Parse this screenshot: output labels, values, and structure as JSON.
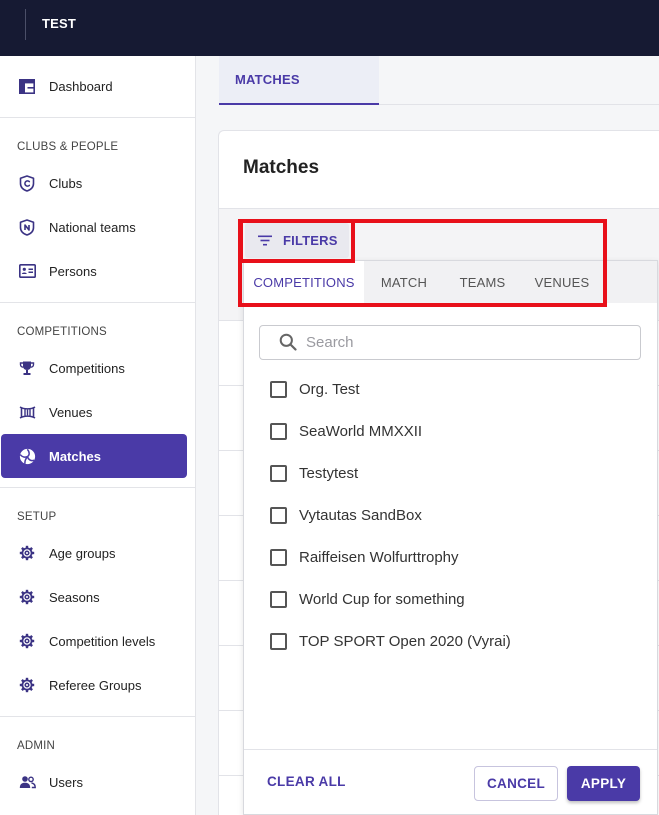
{
  "header": {
    "title": "TEST"
  },
  "sidebar": {
    "dashboard": {
      "label": "Dashboard",
      "icon": "dashboard-icon"
    },
    "sections": [
      {
        "title": "CLUBS & PEOPLE",
        "items": [
          {
            "label": "Clubs",
            "icon": "clubs-shield-icon"
          },
          {
            "label": "National teams",
            "icon": "national-teams-shield-icon"
          },
          {
            "label": "Persons",
            "icon": "id-card-icon"
          }
        ]
      },
      {
        "title": "COMPETITIONS",
        "items": [
          {
            "label": "Competitions",
            "icon": "trophy-icon"
          },
          {
            "label": "Venues",
            "icon": "stadium-icon"
          },
          {
            "label": "Matches",
            "icon": "volleyball-icon",
            "active": true
          }
        ]
      },
      {
        "title": "SETUP",
        "items": [
          {
            "label": "Age groups",
            "icon": "gear-icon"
          },
          {
            "label": "Seasons",
            "icon": "gear-icon"
          },
          {
            "label": "Competition levels",
            "icon": "gear-icon"
          },
          {
            "label": "Referee Groups",
            "icon": "gear-icon"
          }
        ]
      },
      {
        "title": "ADMIN",
        "items": [
          {
            "label": "Users",
            "icon": "users-icon"
          }
        ]
      }
    ]
  },
  "main": {
    "tabs": [
      {
        "label": "MATCHES",
        "active": true
      }
    ],
    "card_title": "Matches",
    "filters_button": {
      "label": "FILTERS",
      "icon": "filter-icon"
    }
  },
  "filter_panel": {
    "tabs": [
      {
        "label": "COMPETITIONS",
        "active": true
      },
      {
        "label": "MATCH",
        "active": false
      },
      {
        "label": "TEAMS",
        "active": false
      },
      {
        "label": "VENUES",
        "active": false
      }
    ],
    "search": {
      "placeholder": "Search",
      "value": "",
      "icon": "search-icon"
    },
    "options": [
      {
        "label": "Org. Test",
        "checked": false
      },
      {
        "label": "SeaWorld MMXXII",
        "checked": false
      },
      {
        "label": "Testytest",
        "checked": false
      },
      {
        "label": "Vytautas SandBox",
        "checked": false
      },
      {
        "label": "Raiffeisen Wolfurttrophy",
        "checked": false
      },
      {
        "label": "World Cup for something",
        "checked": false
      },
      {
        "label": "TOP SPORT Open 2020 (Vyrai)",
        "checked": false
      }
    ],
    "clear_all_label": "CLEAR ALL",
    "cancel_label": "CANCEL",
    "apply_label": "APPLY"
  },
  "colors": {
    "primary": "#4a3aa7",
    "topbar": "#161a33",
    "annotation_highlight": "#e8101a"
  }
}
